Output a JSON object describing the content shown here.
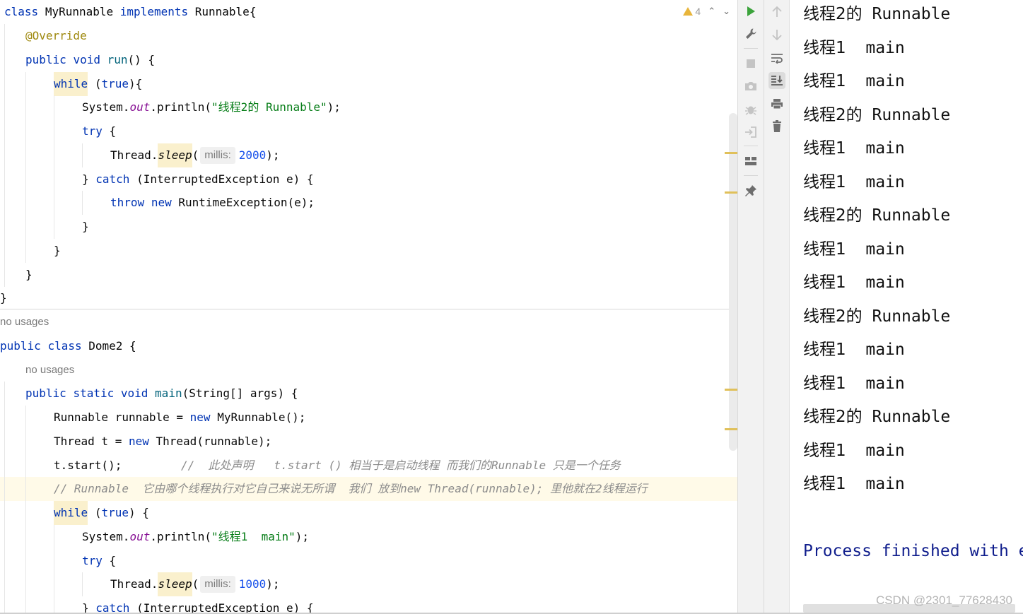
{
  "editor": {
    "inspection": {
      "warning_count": "4"
    },
    "usages": {
      "class_usage": "no usages",
      "method_usage": "no usages"
    },
    "lines": {
      "l1": {
        "kw1": "class",
        "name": "MyRunnable",
        "kw2": "implements",
        "rest": "Runnable{"
      },
      "l2": {
        "ann": "@Override"
      },
      "l3": {
        "kw1": "public",
        "kw2": "void",
        "method": "run",
        "rest": "() {"
      },
      "l4": {
        "kw": "while",
        "p1": "(",
        "cond": "true",
        "p2": "){"
      },
      "l5": {
        "cls": "System.",
        "field": "out",
        "call": ".println(",
        "str": "\"线程2的 Runnable\"",
        "end": ");"
      },
      "l6": {
        "kw": "try",
        "rest": "{"
      },
      "l7": {
        "cls": "Thread.",
        "method": "sleep",
        "p": "(",
        "hint": "millis:",
        "num": "2000",
        "end": ");"
      },
      "l8": {
        "p1": "} ",
        "kw": "catch",
        "rest": "(InterruptedException e) {"
      },
      "l9": {
        "kw1": "throw",
        "kw2": "new",
        "rest": "RuntimeException(e);"
      },
      "l10": {
        "rest": "}"
      },
      "l11": {
        "rest": "}"
      },
      "l12": {
        "rest": "}"
      },
      "l13": {
        "rest": "}"
      },
      "l14": {
        "kw1": "public",
        "kw2": "class",
        "rest": "Dome2 {"
      },
      "l15": {
        "kw1": "public",
        "kw2": "static",
        "kw3": "void",
        "method": "main",
        "rest": "(String[] args) {"
      },
      "l16": {
        "p1": "Runnable runnable = ",
        "kw": "new",
        "rest": "MyRunnable();"
      },
      "l17": {
        "p1": "Thread t = ",
        "kw": "new",
        "rest": "Thread(runnable);"
      },
      "l18": {
        "code": "t.start();",
        "comment": "//  此处声明   t.start () 相当于是启动线程 而我们的Runnable 只是一个任务"
      },
      "l19": {
        "comment": "// Runnable  它由哪个线程执行对它自己来说无所谓  我们 放到new Thread(runnable); 里他就在2线程运行"
      },
      "l20": {
        "kw": "while",
        "p1": "(",
        "cond": "true",
        "p2": ") {"
      },
      "l21": {
        "cls": "System.",
        "field": "out",
        "call": ".println(",
        "str": "\"线程1  main\"",
        "end": ");"
      },
      "l22": {
        "kw": "try",
        "rest": "{"
      },
      "l23": {
        "cls": "Thread.",
        "method": "sleep",
        "p": "(",
        "hint": "millis:",
        "num": "1000",
        "end": ");"
      },
      "l24": {
        "p1": "} ",
        "kw": "catch",
        "rest": "(InterruptedException e) {"
      }
    }
  },
  "toolstrip": {
    "left": [
      "run-icon",
      "wrench-icon",
      "stop-icon",
      "camera-icon",
      "debug-icon",
      "login-icon",
      "layout-icon",
      "pin-icon"
    ],
    "right": [
      "up-arrow-icon",
      "down-arrow-icon",
      "soft-wrap-icon",
      "scroll-to-end-icon",
      "print-icon",
      "trash-icon"
    ]
  },
  "console": {
    "lines": [
      {
        "prefix": "线程2的",
        "word": "Runnable"
      },
      {
        "prefix": "线程1",
        "word": " main"
      },
      {
        "prefix": "线程1",
        "word": " main"
      },
      {
        "prefix": "线程2的",
        "word": "Runnable"
      },
      {
        "prefix": "线程1",
        "word": " main"
      },
      {
        "prefix": "线程1",
        "word": " main"
      },
      {
        "prefix": "线程2的",
        "word": "Runnable"
      },
      {
        "prefix": "线程1",
        "word": " main"
      },
      {
        "prefix": "线程1",
        "word": " main"
      },
      {
        "prefix": "线程2的",
        "word": "Runnable"
      },
      {
        "prefix": "线程1",
        "word": " main"
      },
      {
        "prefix": "线程1",
        "word": " main"
      },
      {
        "prefix": "线程2的",
        "word": "Runnable"
      },
      {
        "prefix": "线程1",
        "word": " main"
      },
      {
        "prefix": "线程1",
        "word": " main"
      }
    ],
    "process_text": "Process finished with e"
  },
  "watermark": "CSDN @2301_77628430",
  "colors": {
    "keyword": "#0033b3",
    "method": "#00627a",
    "string": "#067d17",
    "number": "#1750eb",
    "annotation": "#9e880d",
    "field": "#871094",
    "comment": "#8c8c8c",
    "warning": "#e8b53b",
    "run_green": "#3ba33b",
    "process_blue": "#0f1d8c"
  }
}
